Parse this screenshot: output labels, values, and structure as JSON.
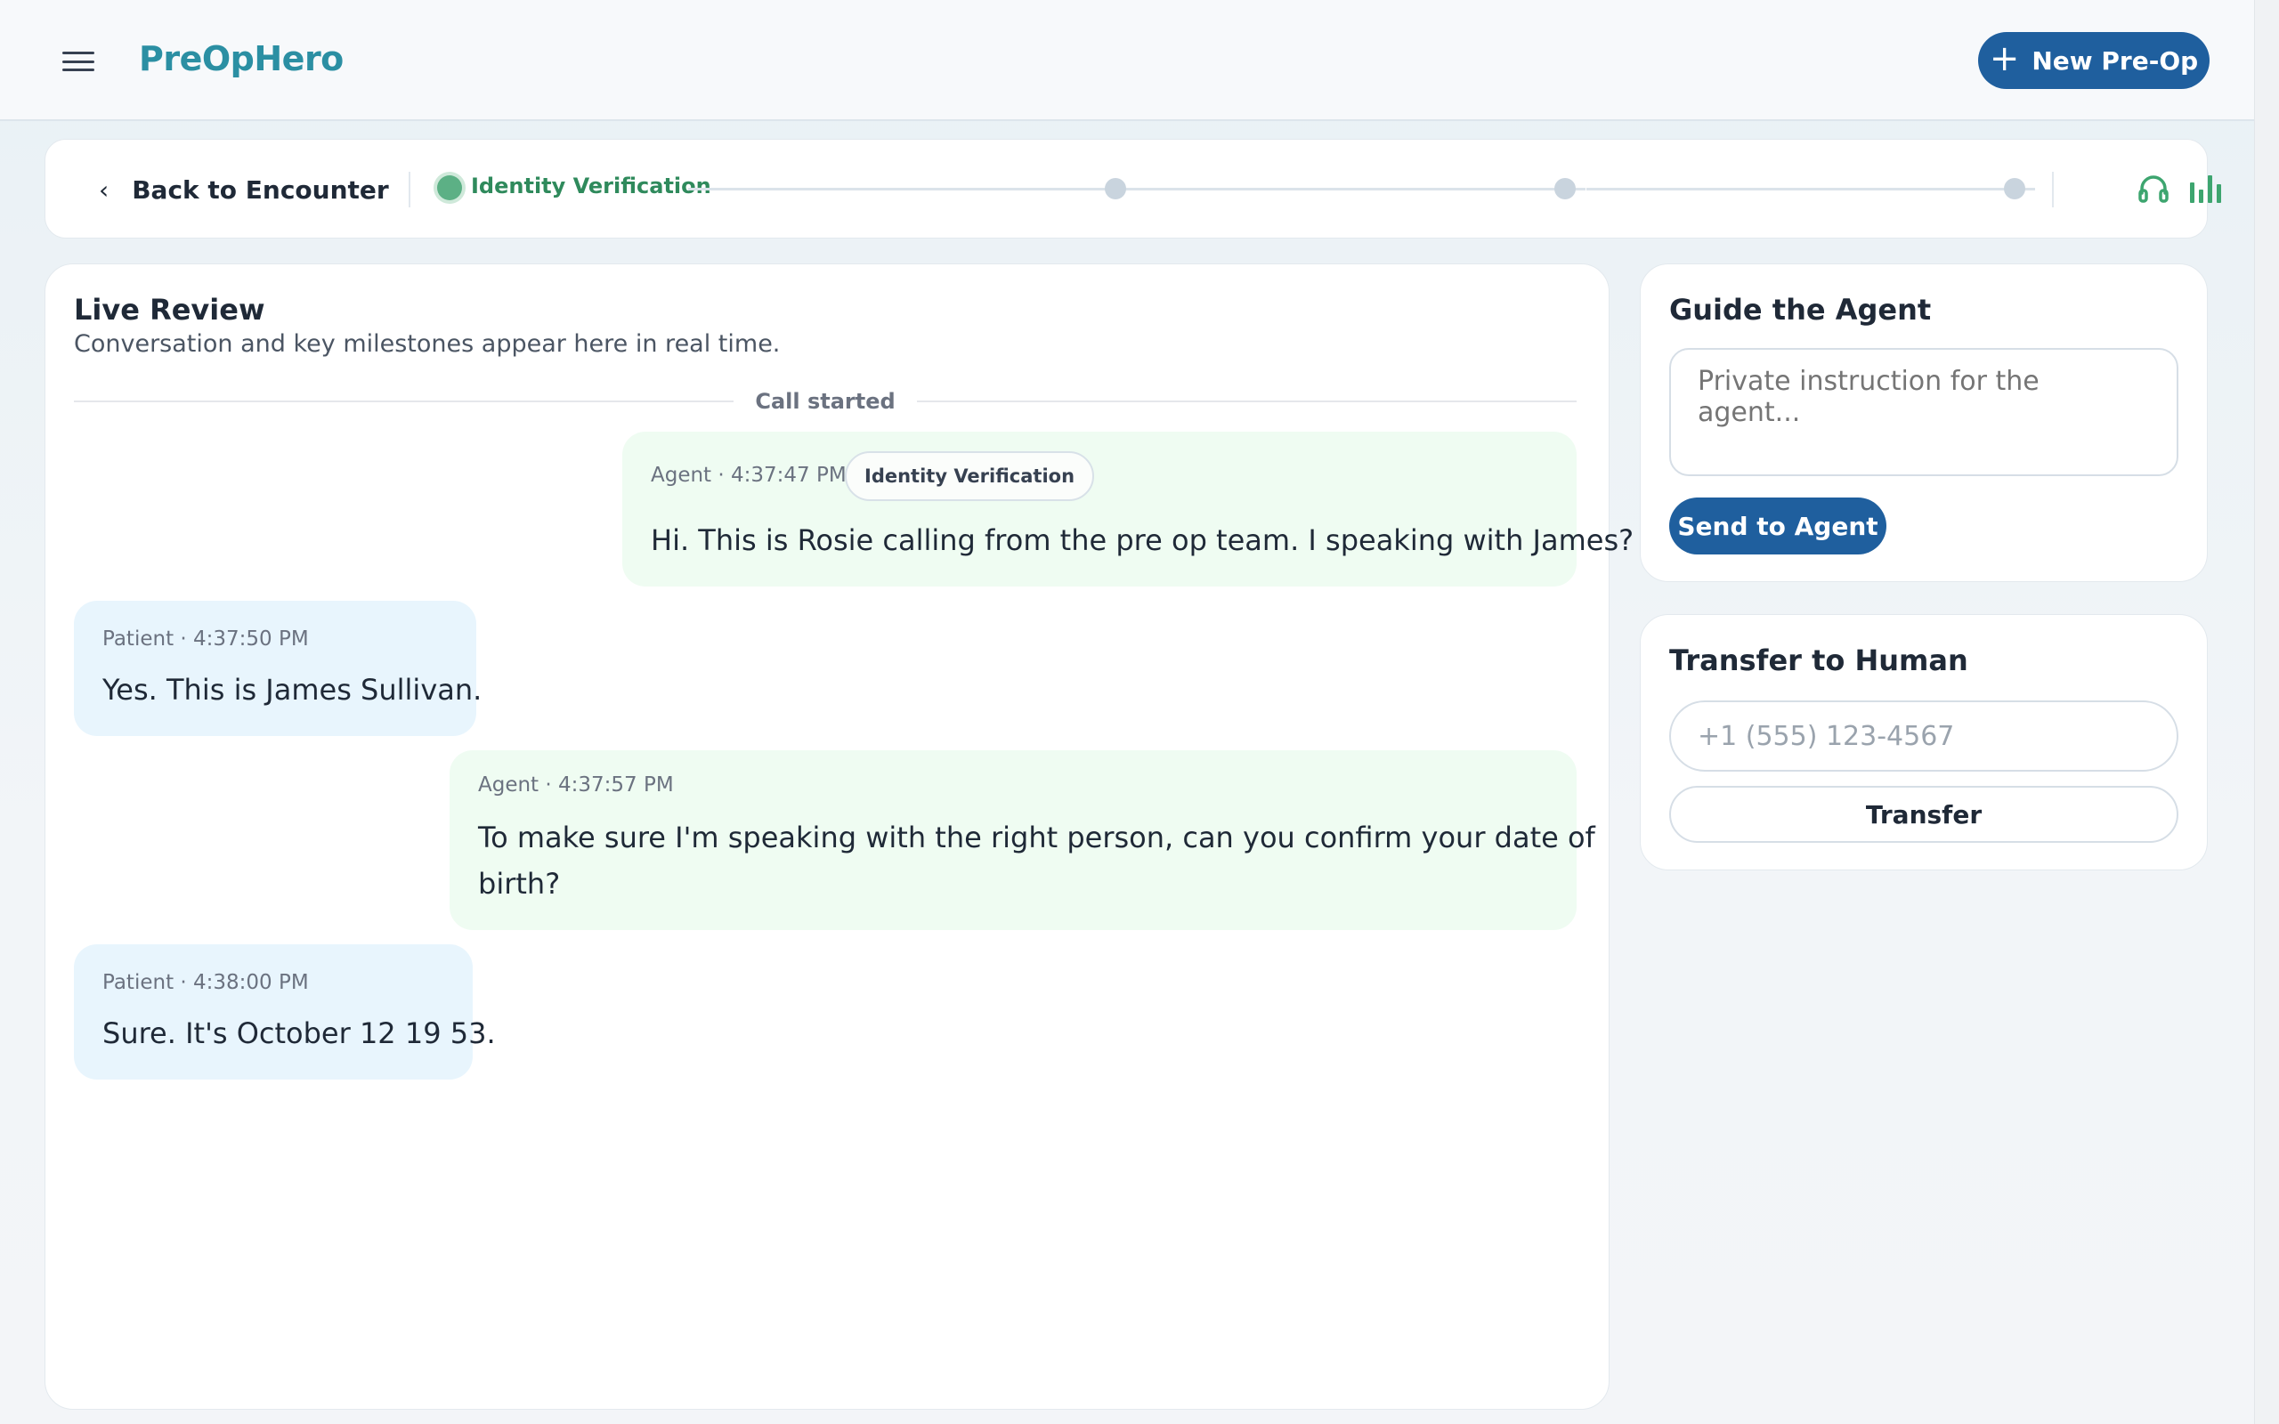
{
  "header": {
    "logo": "PreOpHero",
    "new_preop_label": "New Pre-Op",
    "menu_icon": "hamburger-menu-icon",
    "plus_icon": "plus-icon"
  },
  "progress": {
    "back_label": "Back to Encounter",
    "back_icon": "chevron-left-icon",
    "active_step_label": "Identity Verification",
    "step_count": 4,
    "active_step_index": 0,
    "active_color": "#5cb085",
    "inactive_color": "#c9d4de",
    "right_icons": [
      "headset-icon",
      "audio-bars-icon"
    ]
  },
  "live_review": {
    "title": "Live Review",
    "subtitle": "Conversation and key milestones appear here in real time.",
    "divider_label": "Call started",
    "messages": [
      {
        "speaker": "Agent",
        "meta": "Agent · 4:37:47 PM",
        "tag": "Identity Verification",
        "text": "Hi. This is Rosie calling from the pre op team. I speaking with James?"
      },
      {
        "speaker": "Patient",
        "meta": "Patient · 4:37:50 PM",
        "text": "Yes. This is James Sullivan."
      },
      {
        "speaker": "Agent",
        "meta": "Agent · 4:37:57 PM",
        "text_line1": "To make sure I'm speaking with the right person, can you confirm your date of",
        "text_line2": "birth?"
      },
      {
        "speaker": "Patient",
        "meta": "Patient · 4:38:00 PM",
        "text": "Sure. It's October 12 19 53."
      }
    ]
  },
  "guide": {
    "title": "Guide the Agent",
    "placeholder": "Private instruction for the agent...",
    "send_label": "Send to Agent"
  },
  "transfer": {
    "title": "Transfer to Human",
    "placeholder": "+1 (555) 123-4567",
    "button_label": "Transfer"
  },
  "colors": {
    "brand": "#2b8fa3",
    "primary_button": "#1f5f9e",
    "agent_bubble": "#effcf2",
    "patient_bubble": "#e8f5fd",
    "step_active_text": "#2f8a5c"
  }
}
